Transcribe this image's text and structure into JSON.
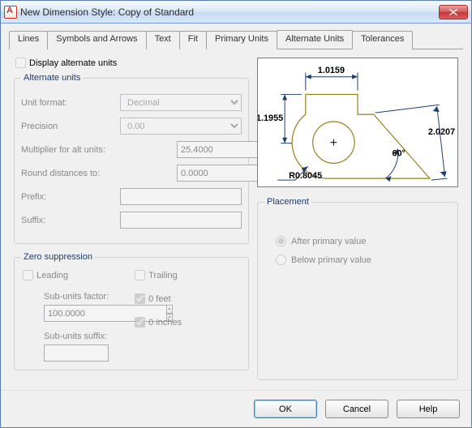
{
  "window": {
    "title": "New Dimension Style: Copy of Standard"
  },
  "tabs": [
    "Lines",
    "Symbols and Arrows",
    "Text",
    "Fit",
    "Primary Units",
    "Alternate Units",
    "Tolerances"
  ],
  "active_tab": "Alternate Units",
  "display_alt": {
    "label": "Display alternate units",
    "checked": false
  },
  "alt_units": {
    "legend": "Alternate units",
    "unit_format": {
      "label": "Unit format:",
      "value": "Decimal"
    },
    "precision": {
      "label": "Precision",
      "value": "0.00"
    },
    "multiplier": {
      "label": "Multiplier for alt units:",
      "value": "25.4000"
    },
    "round": {
      "label": "Round distances  to:",
      "value": "0.0000"
    },
    "prefix": {
      "label": "Prefix:",
      "value": ""
    },
    "suffix": {
      "label": "Suffix:",
      "value": ""
    }
  },
  "zero": {
    "legend": "Zero suppression",
    "leading": {
      "label": "Leading",
      "checked": false
    },
    "trailing": {
      "label": "Trailing",
      "checked": false
    },
    "feet": {
      "label": "0 feet",
      "checked": true
    },
    "inches": {
      "label": "0 inches",
      "checked": true
    },
    "sub_factor": {
      "label": "Sub-units factor:",
      "value": "100.0000"
    },
    "sub_suffix": {
      "label": "Sub-units suffix:",
      "value": ""
    }
  },
  "placement": {
    "legend": "Placement",
    "after": "After primary value",
    "below": "Below primary value",
    "selected": "after"
  },
  "preview": {
    "linear_top": "1.0159",
    "linear_left": "1.1955",
    "diag": "2.0207",
    "angle": "60°",
    "radius": "R0.8045"
  },
  "buttons": {
    "ok": "OK",
    "cancel": "Cancel",
    "help": "Help"
  }
}
